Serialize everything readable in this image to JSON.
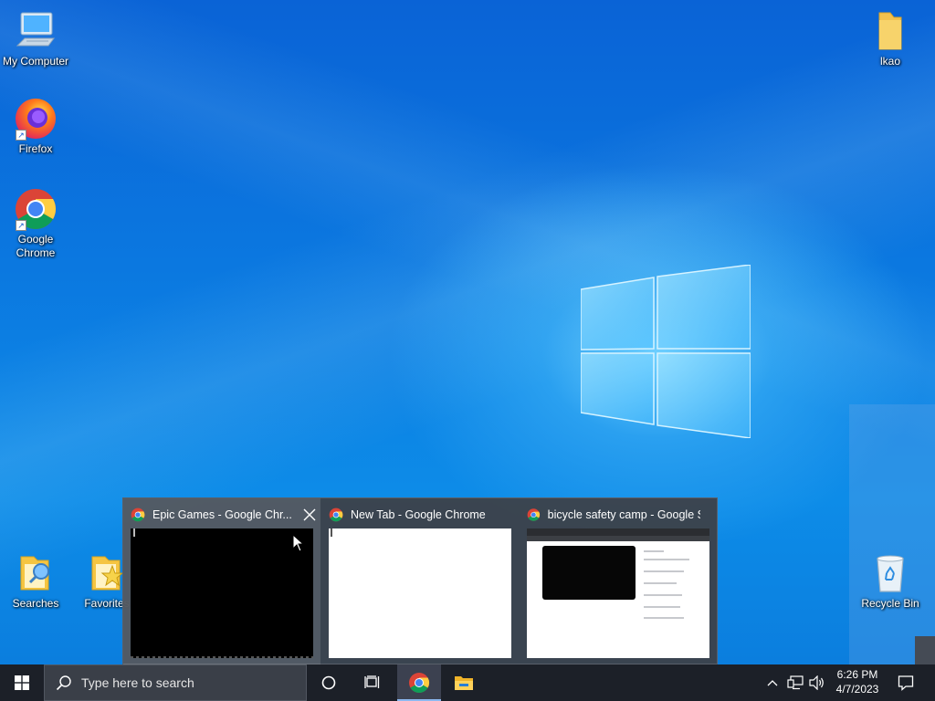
{
  "desktop": {
    "icons": [
      {
        "label": "My Computer",
        "icon": "computer-icon"
      },
      {
        "label": "Firefox",
        "icon": "firefox-icon"
      },
      {
        "label": "Google Chrome",
        "icon": "chrome-icon"
      },
      {
        "label": "Searches",
        "icon": "searches-folder-icon"
      },
      {
        "label": "Favorites",
        "icon": "favorites-folder-icon"
      },
      {
        "label": "lkao",
        "icon": "folder-icon"
      },
      {
        "label": "Recycle Bin",
        "icon": "recycle-bin-icon"
      }
    ]
  },
  "thumbnails": [
    {
      "title": "Epic Games - Google Chr...",
      "icon": "chrome-icon",
      "preview": "black",
      "hovered": true
    },
    {
      "title": "New Tab - Google Chrome",
      "icon": "chrome-icon",
      "preview": "white",
      "hovered": false
    },
    {
      "title": "bicycle safety camp - Google S...",
      "icon": "chrome-icon",
      "preview": "web-page",
      "hovered": false
    }
  ],
  "taskbar": {
    "search_placeholder": "Type here to search",
    "pinned": [
      "chrome-icon",
      "file-explorer-icon"
    ],
    "clock": {
      "time": "6:26 PM",
      "date": "4/7/2023"
    }
  },
  "colors": {
    "wallpaper": "#0b78e0",
    "taskbar": "#1c2028",
    "popup": "#3c424a"
  }
}
